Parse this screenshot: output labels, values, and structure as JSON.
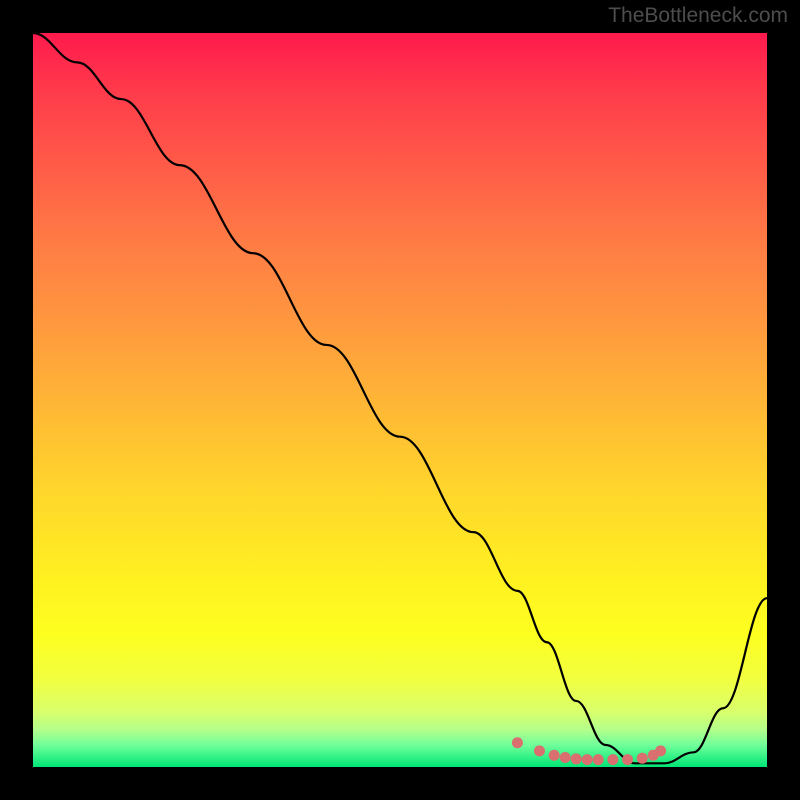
{
  "watermark": "TheBottleneck.com",
  "chart_data": {
    "type": "line",
    "title": "",
    "xlabel": "",
    "ylabel": "",
    "xlim": [
      0,
      100
    ],
    "ylim": [
      0,
      100
    ],
    "series": [
      {
        "name": "curve",
        "x": [
          0,
          6,
          12,
          20,
          30,
          40,
          50,
          60,
          66,
          70,
          74,
          78,
          82,
          86,
          90,
          94,
          100
        ],
        "y": [
          100,
          96,
          91,
          82,
          70,
          57.5,
          45,
          32,
          24,
          17,
          9,
          3,
          0.5,
          0.5,
          2,
          8,
          23
        ]
      }
    ],
    "markers": {
      "name": "highlight-points",
      "color": "#d96f6f",
      "x": [
        66,
        69,
        71,
        72.5,
        74,
        75.5,
        77,
        79,
        81,
        83,
        84.5,
        85.5
      ],
      "y": [
        3.3,
        2.2,
        1.6,
        1.3,
        1.1,
        1.0,
        1.0,
        1.0,
        1.0,
        1.2,
        1.6,
        2.2
      ]
    }
  }
}
